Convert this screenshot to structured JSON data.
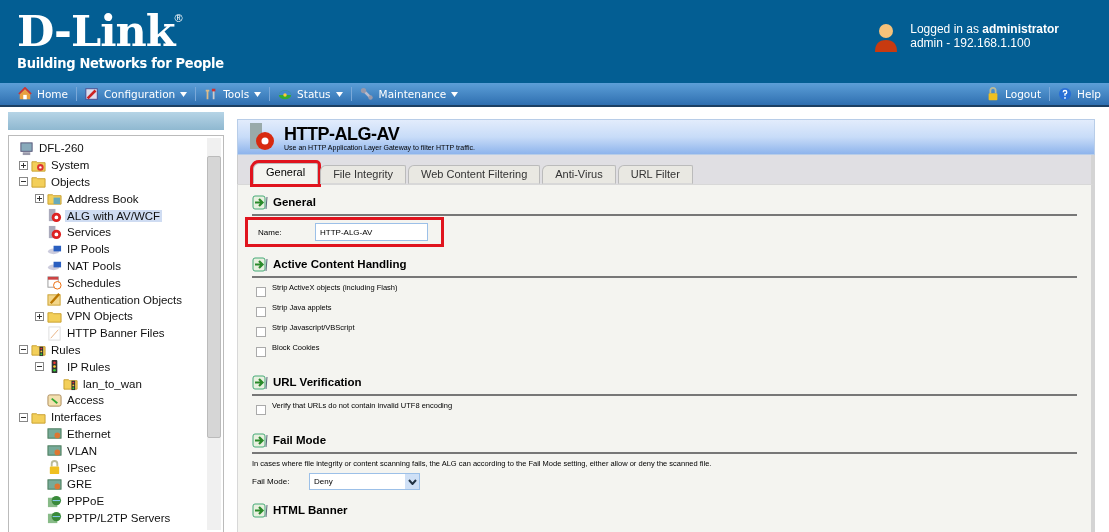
{
  "header": {
    "logo": "D-Link",
    "registered_mark": "®",
    "tagline": "Building Networks for People",
    "login": "Logged in as **administrator**",
    "session": "admin - 192.168.1.100"
  },
  "menu": [
    {
      "label": "Home",
      "dropdown": false
    },
    {
      "label": "Configuration",
      "dropdown": true
    },
    {
      "label": "Tools",
      "dropdown": true
    },
    {
      "label": "Status",
      "dropdown": true
    },
    {
      "label": "Maintenance",
      "dropdown": true
    }
  ],
  "menu_right": [
    {
      "label": "Logout"
    },
    {
      "label": "Help"
    }
  ],
  "tree": {
    "label": "DFL-260",
    "selected": false,
    "children": [
      {
        "label": "System",
        "selected": false,
        "expanded": false
      },
      {
        "label": "Objects",
        "selected": false,
        "expanded": true,
        "children": [
          {
            "label": "Address Book",
            "selected": false,
            "expanded": false
          },
          {
            "label": "ALG with AV/WCF",
            "selected": true
          },
          {
            "label": "Services",
            "selected": false
          },
          {
            "label": "IP Pools",
            "selected": false
          },
          {
            "label": "NAT Pools",
            "selected": false
          },
          {
            "label": "Schedules",
            "selected": false
          },
          {
            "label": "Authentication Objects",
            "selected": false
          },
          {
            "label": "VPN Objects",
            "selected": false,
            "expanded": false
          },
          {
            "label": "HTTP Banner Files",
            "selected": false
          }
        ]
      },
      {
        "label": "Rules",
        "selected": false,
        "expanded": true,
        "children": [
          {
            "label": "IP Rules",
            "selected": false,
            "expanded": true,
            "children": [
              {
                "label": "lan_to_wan",
                "selected": false
              }
            ]
          },
          {
            "label": "Access",
            "selected": false
          }
        ]
      },
      {
        "label": "Interfaces",
        "selected": false,
        "expanded": true,
        "children": [
          {
            "label": "Ethernet",
            "selected": false
          },
          {
            "label": "VLAN",
            "selected": false
          },
          {
            "label": "IPsec",
            "selected": false
          },
          {
            "label": "GRE",
            "selected": false
          },
          {
            "label": "PPPoE",
            "selected": false
          },
          {
            "label": "PPTP/L2TP Servers",
            "selected": false
          }
        ]
      }
    ]
  },
  "page": {
    "title": "HTTP-ALG-AV",
    "subtitle": "Use an HTTP Application Layer Gateway to filter HTTP traffic.",
    "tabs": [
      {
        "label": "General",
        "selected": true,
        "highlighted": true
      },
      {
        "label": "File Integrity",
        "selected": false,
        "highlighted": false
      },
      {
        "label": "Web Content Filtering",
        "selected": false,
        "highlighted": false
      },
      {
        "label": "Anti-Virus",
        "selected": false,
        "highlighted": false
      },
      {
        "label": "URL Filter",
        "selected": false,
        "highlighted": false
      }
    ],
    "sections": [
      {
        "kind": "field",
        "title": "General",
        "label": "Name:",
        "value": "HTTP-ALG-AV",
        "highlighted": true
      },
      {
        "kind": "checkboxes",
        "title": "Active Content Handling",
        "items": [
          {
            "label": "Strip ActiveX objects (including Flash)",
            "checked": false
          },
          {
            "label": "Strip Java applets",
            "checked": false
          },
          {
            "label": "Strip Javascript/VBScript",
            "checked": false
          },
          {
            "label": "Block Cookies",
            "checked": false
          }
        ]
      },
      {
        "kind": "checkboxes",
        "title": "URL Verification",
        "items": [
          {
            "label": "Verify that URLs do not contain invalid UTF8 encoding",
            "checked": false
          }
        ]
      },
      {
        "kind": "select",
        "title": "Fail Mode",
        "description": "In cases where file integrity or content scanning fails, the ALG can according to the Fail Mode setting, either allow or deny the scanned file.",
        "label": "Fail Mode:",
        "value": "Deny"
      },
      {
        "kind": "heading",
        "title": "HTML Banner"
      }
    ]
  }
}
